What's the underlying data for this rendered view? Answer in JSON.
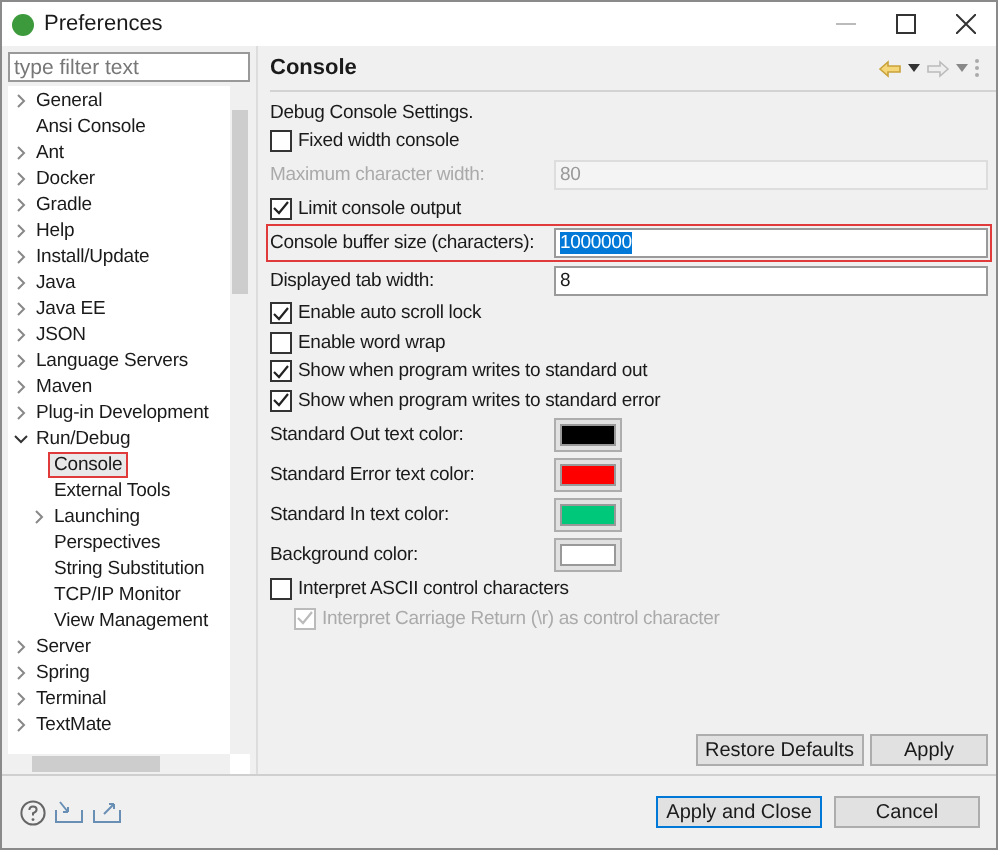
{
  "window": {
    "title": "Preferences"
  },
  "filter": {
    "placeholder": "type filter text"
  },
  "tree": [
    {
      "label": "General",
      "kind": "group",
      "expanded": false,
      "selected": false
    },
    {
      "label": "Ansi Console",
      "kind": "leaf",
      "selected": false
    },
    {
      "label": "Ant",
      "kind": "group",
      "expanded": false,
      "selected": false
    },
    {
      "label": "Docker",
      "kind": "group",
      "expanded": false,
      "selected": false
    },
    {
      "label": "Gradle",
      "kind": "group",
      "expanded": false,
      "selected": false
    },
    {
      "label": "Help",
      "kind": "group",
      "expanded": false,
      "selected": false
    },
    {
      "label": "Install/Update",
      "kind": "group",
      "expanded": false,
      "selected": false
    },
    {
      "label": "Java",
      "kind": "group",
      "expanded": false,
      "selected": false
    },
    {
      "label": "Java EE",
      "kind": "group",
      "expanded": false,
      "selected": false
    },
    {
      "label": "JSON",
      "kind": "group",
      "expanded": false,
      "selected": false
    },
    {
      "label": "Language Servers",
      "kind": "group",
      "expanded": false,
      "selected": false
    },
    {
      "label": "Maven",
      "kind": "group",
      "expanded": false,
      "selected": false
    },
    {
      "label": "Plug-in Development",
      "kind": "group",
      "expanded": false,
      "selected": false
    },
    {
      "label": "Run/Debug",
      "kind": "group",
      "expanded": true,
      "selected": false,
      "children": [
        {
          "label": "Console",
          "kind": "leaf",
          "selected": true
        },
        {
          "label": "External Tools",
          "kind": "leaf",
          "selected": false
        },
        {
          "label": "Launching",
          "kind": "group",
          "expanded": false,
          "selected": false
        },
        {
          "label": "Perspectives",
          "kind": "leaf",
          "selected": false
        },
        {
          "label": "String Substitution",
          "kind": "leaf",
          "selected": false
        },
        {
          "label": "TCP/IP Monitor",
          "kind": "leaf",
          "selected": false
        },
        {
          "label": "View Management",
          "kind": "leaf",
          "selected": false
        }
      ]
    },
    {
      "label": "Server",
      "kind": "group",
      "expanded": false,
      "selected": false
    },
    {
      "label": "Spring",
      "kind": "group",
      "expanded": false,
      "selected": false
    },
    {
      "label": "Terminal",
      "kind": "group",
      "expanded": false,
      "selected": false
    },
    {
      "label": "TextMate",
      "kind": "group",
      "expanded": false,
      "selected": false
    }
  ],
  "page": {
    "title": "Console",
    "settings": [
      {
        "kind": "text",
        "label": "Debug Console Settings.",
        "disabled": false
      },
      {
        "kind": "checkbox",
        "label": "Fixed width console",
        "checked": false,
        "disabled": false
      },
      {
        "kind": "field",
        "label": "Maximum character width:",
        "value": "80",
        "disabled": true,
        "highlighted": false
      },
      {
        "kind": "checkbox",
        "label": "Limit console output",
        "checked": true,
        "disabled": false
      },
      {
        "kind": "field",
        "label": "Console buffer size (characters):",
        "value": "1000000",
        "disabled": false,
        "highlighted": true
      },
      {
        "kind": "field",
        "label": "Displayed tab width:",
        "value": "8",
        "disabled": false,
        "highlighted": false
      },
      {
        "kind": "checkbox",
        "label": "Enable auto scroll lock",
        "checked": true,
        "disabled": false
      },
      {
        "kind": "checkbox",
        "label": "Enable word wrap",
        "checked": false,
        "disabled": false
      },
      {
        "kind": "checkbox",
        "label": "Show when program writes to standard out",
        "checked": true,
        "disabled": false
      },
      {
        "kind": "checkbox",
        "label": "Show when program writes to standard error",
        "checked": true,
        "disabled": false
      },
      {
        "kind": "color",
        "label": "Standard Out text color:",
        "color": "#000000"
      },
      {
        "kind": "color",
        "label": "Standard Error text color:",
        "color": "#ff0000"
      },
      {
        "kind": "color",
        "label": "Standard In text color:",
        "color": "#00c87a"
      },
      {
        "kind": "color",
        "label": "Background color:",
        "color": "#ffffff"
      },
      {
        "kind": "checkbox",
        "label": "Interpret ASCII control characters",
        "checked": false,
        "disabled": false
      },
      {
        "kind": "subcheckbox",
        "label": "Interpret Carriage Return (\\r) as control character",
        "checked": true,
        "disabled": true
      }
    ],
    "buttons": [
      "Restore Defaults",
      "Apply"
    ]
  },
  "footer_buttons": [
    "Apply and Close",
    "Cancel"
  ]
}
